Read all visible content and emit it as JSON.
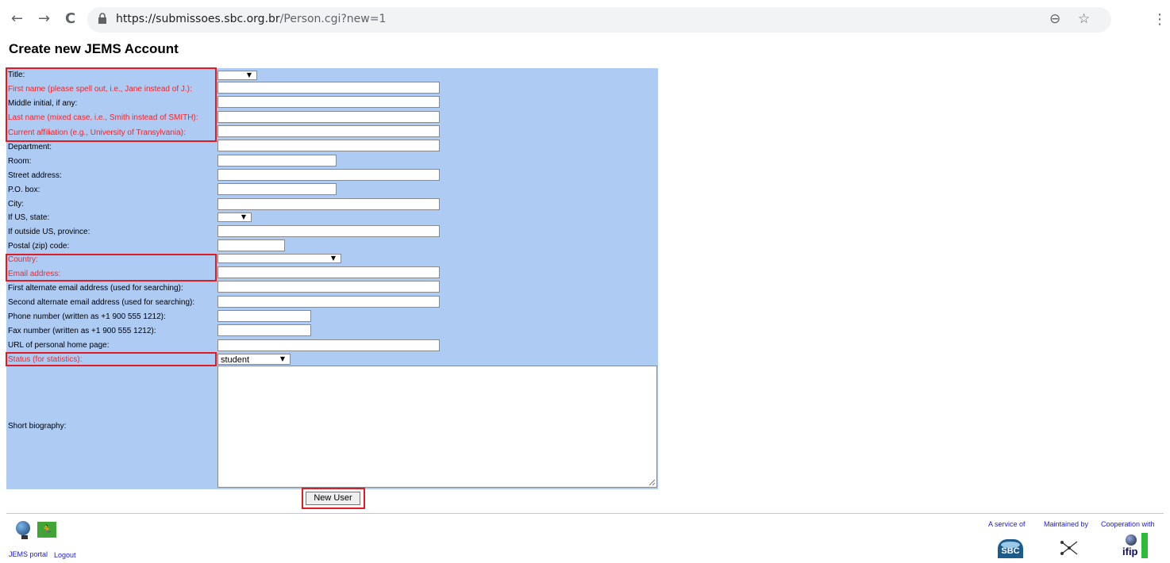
{
  "browser": {
    "url_host": "https://submissoes.sbc.org.br",
    "url_path": "/Person.cgi?new=1",
    "back_icon": "arrow-left-icon",
    "forward_icon": "arrow-right-icon",
    "reload_icon": "reload-icon",
    "back_glyph": "←",
    "forward_glyph": "→",
    "reload_glyph": "C",
    "zoom_glyph": "⊖",
    "star_glyph": "☆",
    "menu_glyph": "⋮"
  },
  "page": {
    "title": "Create new JEMS Account"
  },
  "form": {
    "labels": {
      "title": "Title:",
      "first_name": "First name (please spell out, i.e., Jane instead of J.):",
      "middle_initial": "Middle initial, if any:",
      "last_name": "Last name (mixed case, i.e., Smith instead of SMITH):",
      "affiliation": "Current affiliation (e.g., University of Transylvania):",
      "department": "Department:",
      "room": "Room:",
      "street": "Street address:",
      "po_box": "P.O. box:",
      "city": "City:",
      "us_state": "If US, state:",
      "province": "If outside US, province:",
      "postal": "Postal (zip) code:",
      "country": "Country:",
      "email": "Email address:",
      "alt_email_1": "First alternate email address (used for searching):",
      "alt_email_2": "Second alternate email address (used for searching):",
      "phone": "Phone number (written as +1 900 555 1212):",
      "fax": "Fax number (written as +1 900 555 1212):",
      "homepage": "URL of personal home page:",
      "status": "Status (for statistics):",
      "biography": "Short biography:"
    },
    "values": {
      "title": "",
      "us_state": "",
      "country": "",
      "status": "student"
    },
    "select_arrow": "▼",
    "submit_label": "New User"
  },
  "footer": {
    "jems_portal": "JEMS portal",
    "logout": "Logout",
    "service_of": "A service of",
    "maintained_by": "Maintained by",
    "cooperation_with": "Cooperation with",
    "sbc_logo_text": "SBC",
    "ifip_logo_text": "ifip",
    "exit_glyph": "🏃"
  },
  "colors": {
    "form_background": "#aecbf4",
    "required_label": "#ff2020",
    "highlight_box": "#e01b24",
    "footer_link": "#1a1ad8"
  }
}
